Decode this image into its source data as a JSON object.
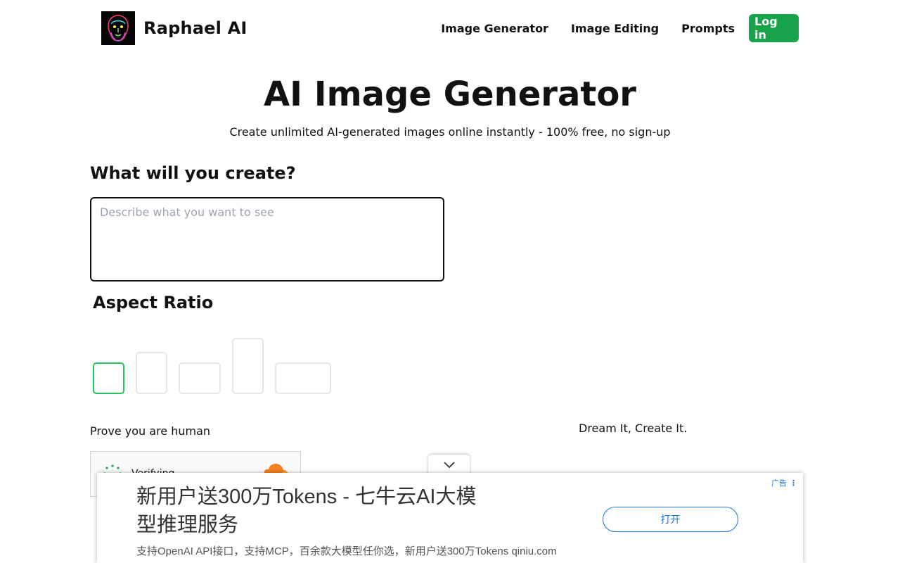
{
  "header": {
    "brand": "Raphael AI",
    "nav": [
      "Image Generator",
      "Image Editing",
      "Prompts"
    ],
    "login": "Log in"
  },
  "hero": {
    "title": "AI Image Generator",
    "subtitle": "Create unlimited AI-generated images online instantly - 100% free, no sign-up"
  },
  "form": {
    "create_title": "What will you create?",
    "prompt_placeholder": "Describe what you want to see",
    "prompt_value": "",
    "ratio_title": "Aspect Ratio",
    "human_label": "Prove you are human",
    "captcha_text": "Verifying..."
  },
  "side": {
    "tagline": "Dream It, Create It."
  },
  "ad": {
    "badge": "广告",
    "title": "新用户送300万Tokens - 七牛云AI大模型推理服务",
    "description": "支持OpenAI API接口，支持MCP，百余款大模型任你选，新用户送300万Tokens qiniu.com",
    "button": "打开"
  },
  "colors": {
    "accent": "#16a34a",
    "selected_border": "#22c55e",
    "ad_link": "#1a73e8"
  }
}
